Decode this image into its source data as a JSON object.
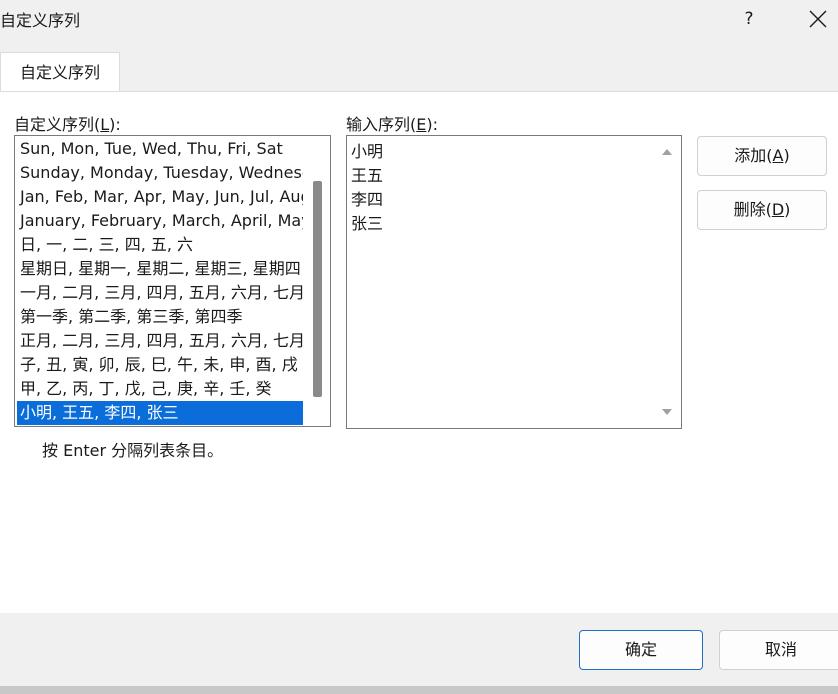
{
  "window": {
    "title": "自定义序列",
    "help_label": "?"
  },
  "tabs": [
    {
      "label": "自定义序列"
    }
  ],
  "left": {
    "label_prefix": "自定义序列(",
    "label_key": "L",
    "label_suffix": "):",
    "items": [
      "Sun, Mon, Tue, Wed, Thu, Fri, Sat",
      "Sunday, Monday, Tuesday, Wednesday",
      "Jan, Feb, Mar, Apr, May, Jun, Jul, Aug",
      "January, February, March, April, May",
      "日, 一, 二, 三, 四, 五, 六",
      "星期日, 星期一, 星期二, 星期三, 星期四",
      "一月, 二月, 三月, 四月, 五月, 六月, 七月",
      "第一季, 第二季, 第三季, 第四季",
      "正月, 二月, 三月, 四月, 五月, 六月, 七月",
      "子, 丑, 寅, 卯, 辰, 巳, 午, 未, 申, 酉, 戌",
      "甲, 乙, 丙, 丁, 戊, 己, 庚, 辛, 壬, 癸",
      "小明, 王五, 李四, 张三"
    ],
    "selected_index": 11
  },
  "right": {
    "label_prefix": "输入序列(",
    "label_key": "E",
    "label_suffix": "):",
    "lines": [
      "小明",
      "王五",
      "李四",
      "张三"
    ]
  },
  "buttons": {
    "add_prefix": "添加(",
    "add_key": "A",
    "add_suffix": ")",
    "delete_prefix": "删除(",
    "delete_key": "D",
    "delete_suffix": ")",
    "ok": "确定",
    "cancel": "取消"
  },
  "hint": "按 Enter 分隔列表条目。",
  "colors": {
    "selection": "#0a6dd9",
    "ok_border": "#1f6fc2"
  }
}
